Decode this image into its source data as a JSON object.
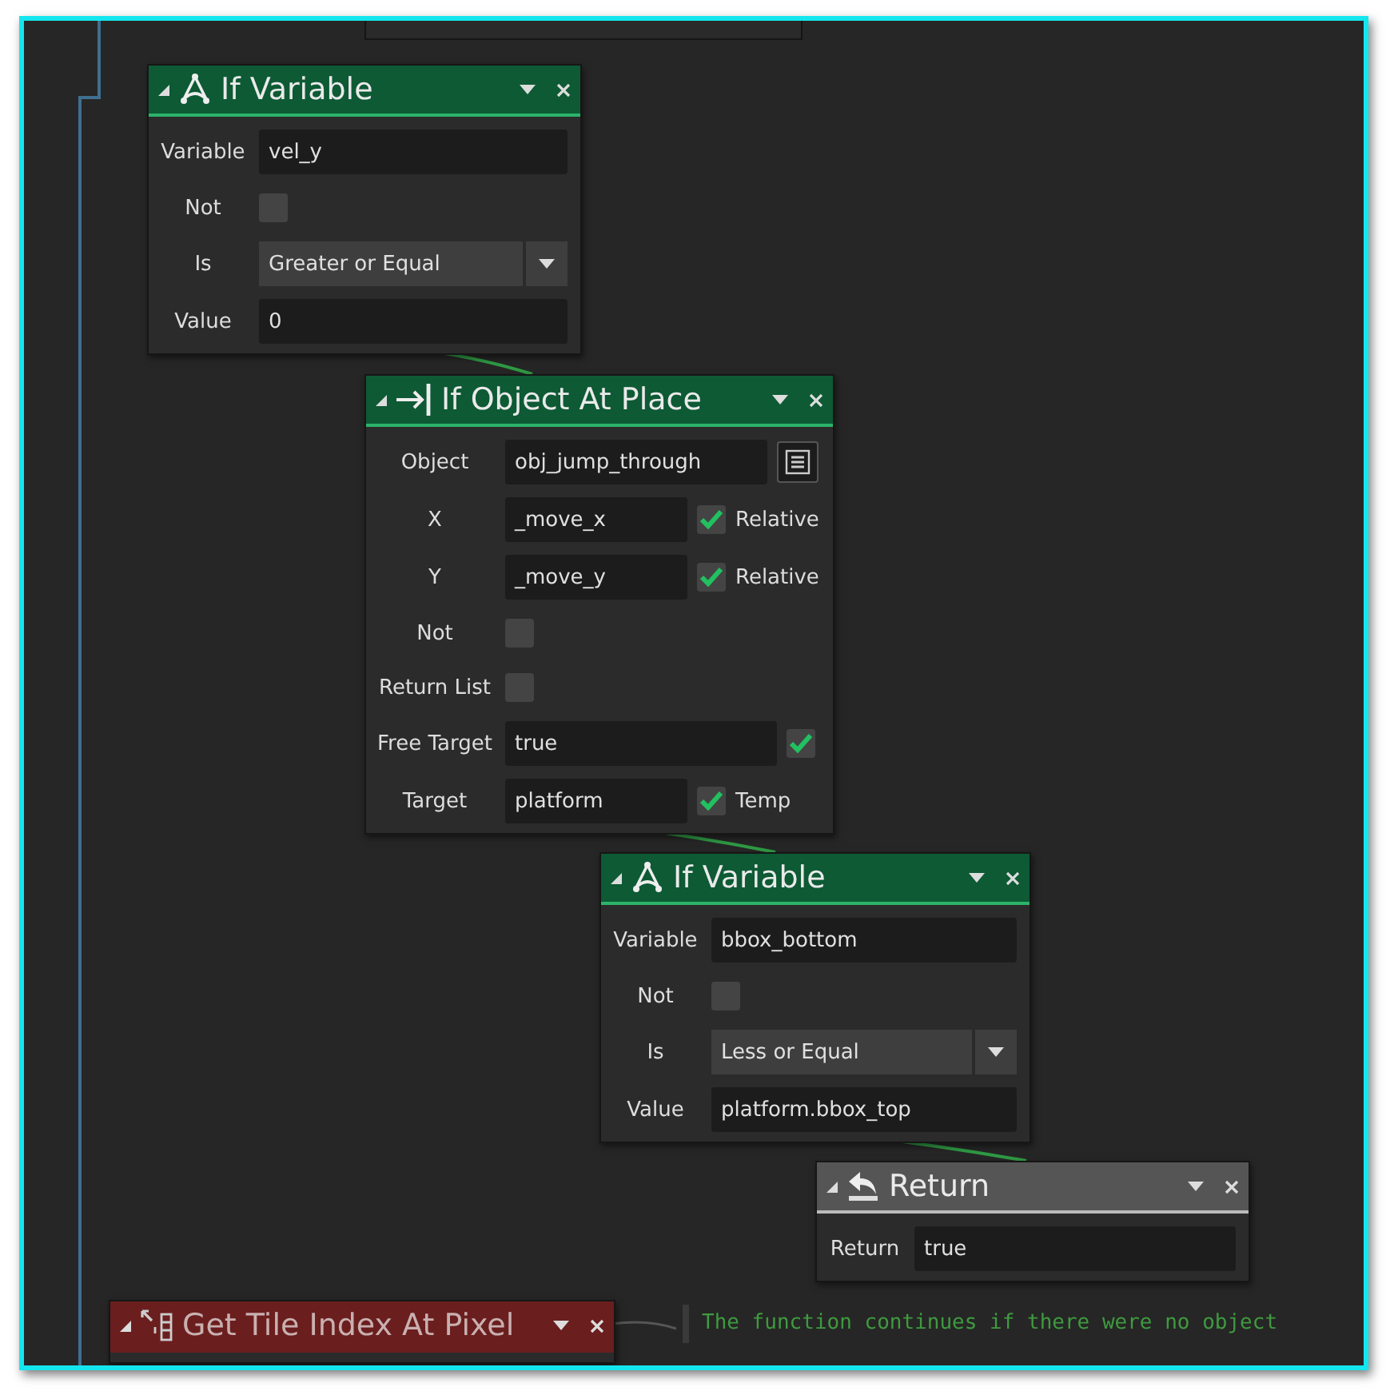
{
  "nodes": [
    {
      "kind": "if_variable",
      "title": "If Variable",
      "color": "#0d5a35",
      "fields": [
        {
          "kind": "text",
          "label": "Variable",
          "value": "vel_y"
        },
        {
          "kind": "checkbox",
          "label": "Not",
          "checked": false
        },
        {
          "kind": "dropdown",
          "label": "Is",
          "value": "Greater or Equal"
        },
        {
          "kind": "text",
          "label": "Value",
          "value": "0"
        }
      ]
    },
    {
      "kind": "if_object",
      "title": "If Object At Place",
      "color": "#0d5a35",
      "fields": [
        {
          "kind": "text_button",
          "label": "Object",
          "value": "obj_jump_through"
        },
        {
          "kind": "text_check",
          "label": "X",
          "value": "_move_x",
          "checked": true,
          "check_label": "Relative"
        },
        {
          "kind": "text_check",
          "label": "Y",
          "value": "_move_y",
          "checked": true,
          "check_label": "Relative"
        },
        {
          "kind": "checkbox",
          "label": "Not",
          "checked": false
        },
        {
          "kind": "checkbox",
          "label": "Return List",
          "checked": false
        },
        {
          "kind": "text_check",
          "label": "Free Target",
          "value": "true",
          "checked": true
        },
        {
          "kind": "text_check",
          "label": "Target",
          "value": "platform",
          "checked": true,
          "check_label": "Temp"
        }
      ]
    },
    {
      "kind": "if_variable",
      "title": "If Variable",
      "color": "#0d5a35",
      "fields": [
        {
          "kind": "text",
          "label": "Variable",
          "value": "bbox_bottom"
        },
        {
          "kind": "checkbox",
          "label": "Not",
          "checked": false
        },
        {
          "kind": "dropdown",
          "label": "Is",
          "value": "Less or Equal"
        },
        {
          "kind": "text",
          "label": "Value",
          "value": "platform.bbox_top"
        }
      ]
    },
    {
      "kind": "return",
      "title": "Return",
      "color": "#555555",
      "fields": [
        {
          "kind": "text",
          "label": "Return",
          "value": "true"
        }
      ]
    },
    {
      "kind": "tile",
      "title": "Get Tile Index At Pixel",
      "color": "#6b1e1e"
    }
  ],
  "comment": {
    "lines": [
      "The function continues if there were no object"
    ]
  }
}
